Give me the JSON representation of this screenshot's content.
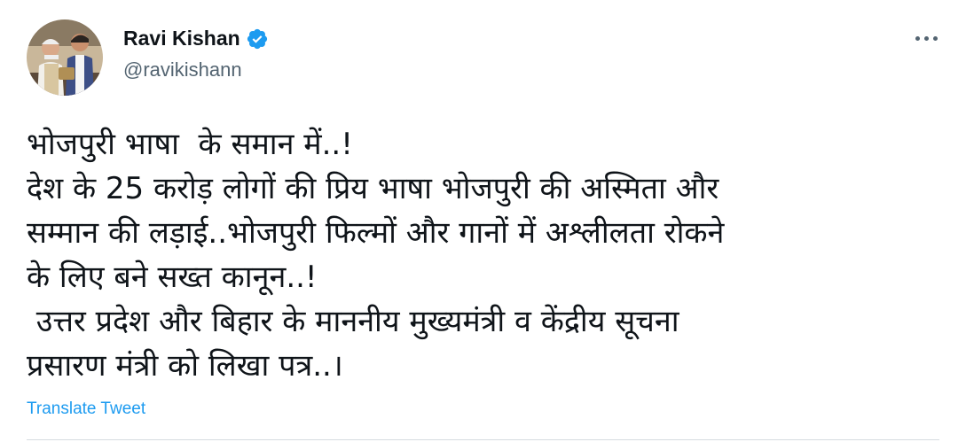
{
  "author": {
    "name": "Ravi Kishan",
    "handle": "@ravikishann",
    "verified": true,
    "verified_color": "#1d9bf0"
  },
  "tweet": {
    "lines": [
      "भोजपुरी भाषा  के समान में..!",
      "देश के 25 करोड़ लोगों की प्रिय भाषा भोजपुरी की अस्मिता और",
      "सम्मान की लड़ाई..भोजपुरी फिल्मों और गानों में अश्लीलता रोकने",
      "के लिए बने सख्त कानून..!",
      " उत्तर प्रदेश और बिहार के माननीय मुख्यमंत्री व केंद्रीय सूचना",
      "प्रसारण मंत्री को लिखा पत्र..।"
    ]
  },
  "actions": {
    "translate_label": "Translate Tweet",
    "more_icon": "more-horizontal-icon"
  },
  "colors": {
    "link": "#1d9bf0",
    "secondary_text": "#536471",
    "primary_text": "#0f1419"
  }
}
